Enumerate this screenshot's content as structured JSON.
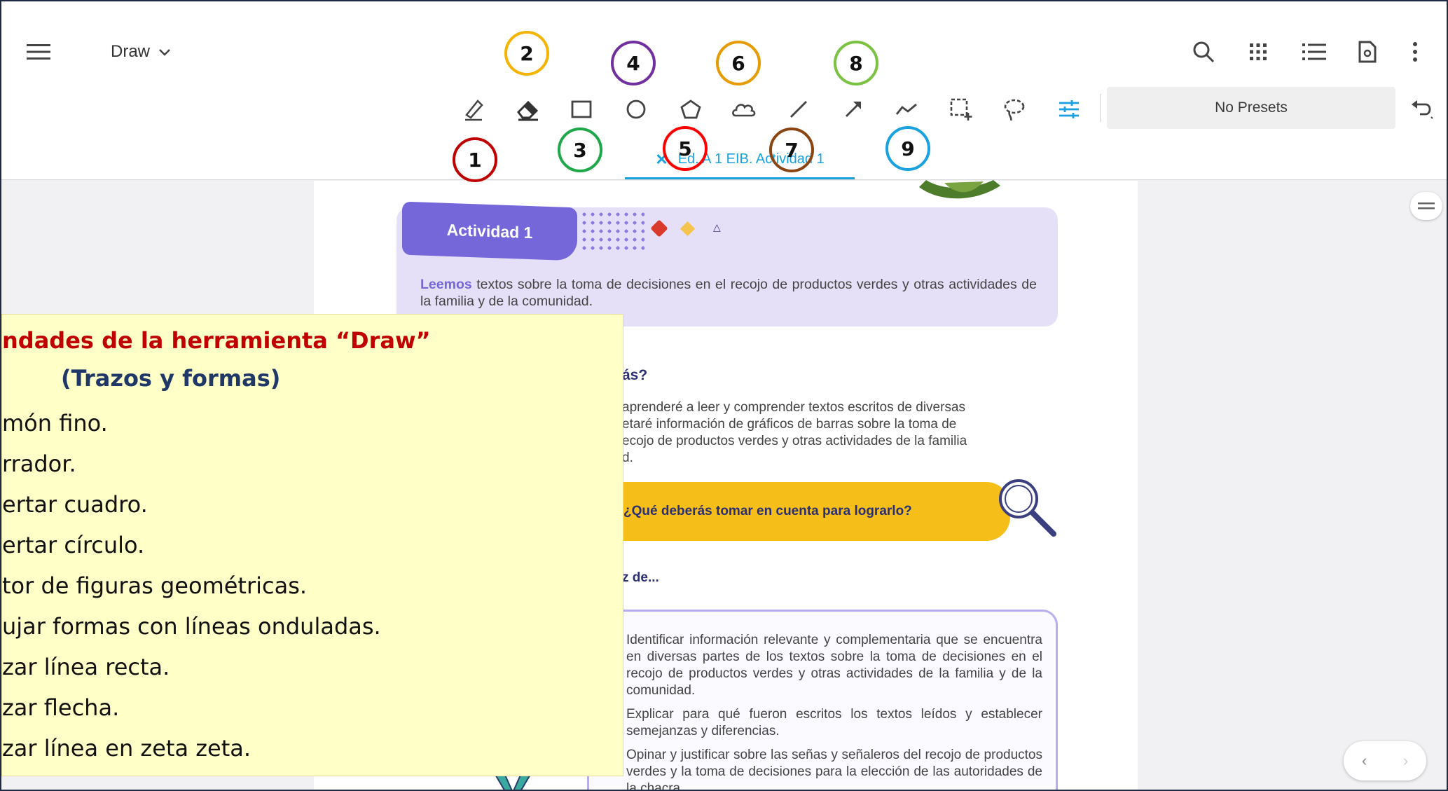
{
  "app": {
    "mode_label": "Draw",
    "document_tab": "Ed. A 1 EIB. Actividad 1",
    "presets_label": "No Presets"
  },
  "toolbar": {
    "tools": [
      {
        "name": "pen",
        "icon": "pen-icon"
      },
      {
        "name": "eraser",
        "icon": "eraser-icon"
      },
      {
        "name": "rectangle",
        "icon": "rectangle-icon"
      },
      {
        "name": "circle",
        "icon": "circle-icon"
      },
      {
        "name": "polygon",
        "icon": "pentagon-icon"
      },
      {
        "name": "cloud",
        "icon": "cloud-icon"
      },
      {
        "name": "line",
        "icon": "line-icon"
      },
      {
        "name": "arrow",
        "icon": "arrow-icon"
      },
      {
        "name": "polyline",
        "icon": "zigzag-icon"
      },
      {
        "name": "area-select",
        "icon": "selection-add-icon"
      },
      {
        "name": "lasso",
        "icon": "lasso-icon"
      },
      {
        "name": "settings",
        "icon": "sliders-icon"
      }
    ],
    "accent_color": "#1aa1e0"
  },
  "callouts": [
    {
      "number": "1",
      "color": "#c00000"
    },
    {
      "number": "2",
      "color": "#f4b400"
    },
    {
      "number": "3",
      "color": "#1ea84a"
    },
    {
      "number": "4",
      "color": "#7030a0"
    },
    {
      "number": "5",
      "color": "#ff0000"
    },
    {
      "number": "6",
      "color": "#e69b00"
    },
    {
      "number": "7",
      "color": "#8b4513"
    },
    {
      "number": "8",
      "color": "#7cc242"
    },
    {
      "number": "9",
      "color": "#1aa1e0"
    }
  ],
  "document": {
    "activity_label": "Actividad 1",
    "activity_lead": "Leemos",
    "activity_text": " textos sobre la toma de decisiones en el recojo de productos verdes y otras actividades de la familia y de la comunidad.",
    "heading": "ás?",
    "paragraph": "aprenderé a leer y comprender textos escritos de diversas\netaré información de gráficos de barras sobre la toma de\necojo de productos verdes y otras  actividades de la familia\nd.",
    "question": "¿Qué deberás tomar en cuenta para lograrlo?",
    "capaz": "z de...",
    "goals": [
      "Identificar información relevante y complementaria que se encuentra en diversas partes de los textos sobre la toma de decisiones en el recojo de productos verdes y otras actividades de la familia y de la comunidad.",
      "Explicar para qué fueron escritos los textos leídos y establecer semejanzas y diferencias.",
      "Opinar y justificar sobre las señas y señaleros del recojo de productos verdes y la toma de decisiones para la elección de las autoridades de la chacra."
    ]
  },
  "note": {
    "title": "ndades de la herramienta “Draw”",
    "subtitle": "(Trazos y formas)",
    "items": [
      "món fino.",
      "rrador.",
      "ertar cuadro.",
      "ertar círculo.",
      "tor de figuras geométricas.",
      "ujar formas con líneas onduladas.",
      "zar línea recta.",
      "zar flecha.",
      "zar línea en zeta zeta."
    ]
  },
  "pager": {
    "prev": "‹",
    "next": "›"
  }
}
